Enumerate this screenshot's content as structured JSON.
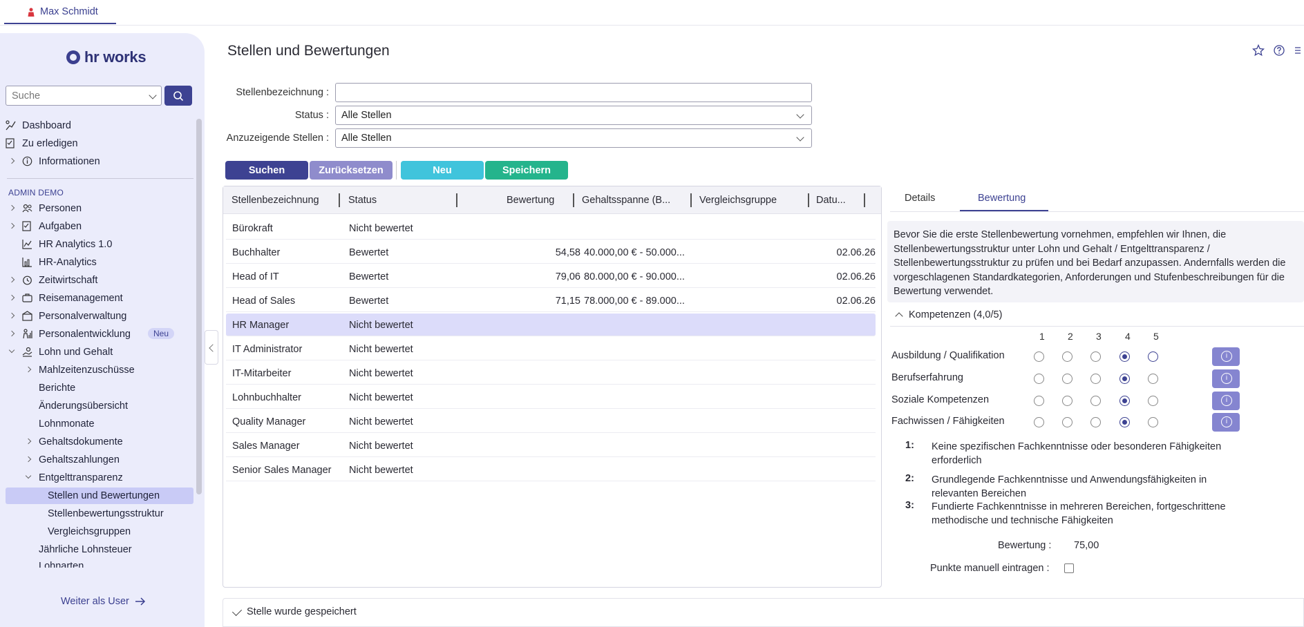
{
  "user_tab": {
    "name": "Max Schmidt"
  },
  "sidebar": {
    "logo_text": "hr works",
    "search_placeholder": "Suche",
    "top_items": [
      {
        "label": "Dashboard",
        "icon": "dashboard-icon"
      },
      {
        "label": "Zu erledigen",
        "icon": "todo-icon"
      },
      {
        "label": "Informationen",
        "icon": "info-icon"
      }
    ],
    "section_label": "ADMIN DEMO",
    "items": [
      {
        "label": "Personen",
        "icon": "people-icon"
      },
      {
        "label": "Aufgaben",
        "icon": "tasks-icon"
      },
      {
        "label": "HR Analytics 1.0",
        "icon": "line-chart-icon"
      },
      {
        "label": "HR-Analytics",
        "icon": "bar-chart-icon"
      },
      {
        "label": "Zeitwirtschaft",
        "icon": "clock-icon"
      },
      {
        "label": "Reisemanagement",
        "icon": "suitcase-icon"
      },
      {
        "label": "Personalverwaltung",
        "icon": "building-icon"
      },
      {
        "label": "Personalentwicklung",
        "icon": "development-icon",
        "badge": "Neu"
      },
      {
        "label": "Lohn und Gehalt",
        "icon": "payroll-icon"
      }
    ],
    "payroll_children": [
      "Mahlzeitenzuschüsse",
      "Berichte",
      "Änderungsübersicht",
      "Lohnmonate",
      "Gehaltsdokumente",
      "Gehaltszahlungen",
      "Entgelttransparenz"
    ],
    "transparency_children": [
      "Stellen und Bewertungen",
      "Stellenbewertungsstruktur",
      "Vergleichsgruppen"
    ],
    "after_items": [
      "Jährliche Lohnsteuer",
      "Lohnarten"
    ],
    "weiter_label": "Weiter als User"
  },
  "page": {
    "title": "Stellen und Bewertungen"
  },
  "filters": {
    "title_label": "Stellenbezeichnung :",
    "title_value": "",
    "status_label": "Status :",
    "status_value": "Alle Stellen",
    "show_label": "Anzuzeigende Stellen :",
    "show_value": "Alle Stellen"
  },
  "buttons": {
    "search": "Suchen",
    "reset": "Zurücksetzen",
    "new": "Neu",
    "save": "Speichern"
  },
  "table": {
    "columns": [
      "Stellenbezeichnung",
      "Status",
      "Bewertung",
      "Gehaltsspanne (B...",
      "Vergleichsgruppe",
      "Datu..."
    ],
    "rows": [
      {
        "name": "Bürokraft",
        "status": "Nicht bewertet",
        "score": "",
        "range": "",
        "group": "",
        "date": ""
      },
      {
        "name": "Buchhalter",
        "status": "Bewertet",
        "score": "54,58",
        "range": "40.000,00 € - 50.000...",
        "group": "",
        "date": "02.06.26"
      },
      {
        "name": "Head of IT",
        "status": "Bewertet",
        "score": "79,06",
        "range": "80.000,00 € - 90.000...",
        "group": "",
        "date": "02.06.26"
      },
      {
        "name": "Head of Sales",
        "status": "Bewertet",
        "score": "71,15",
        "range": "78.000,00 € - 89.000...",
        "group": "",
        "date": "02.06.26"
      },
      {
        "name": "HR Manager",
        "status": "Nicht bewertet",
        "score": "",
        "range": "",
        "group": "",
        "date": ""
      },
      {
        "name": "IT Administrator",
        "status": "Nicht bewertet",
        "score": "",
        "range": "",
        "group": "",
        "date": ""
      },
      {
        "name": "IT-Mitarbeiter",
        "status": "Nicht bewertet",
        "score": "",
        "range": "",
        "group": "",
        "date": ""
      },
      {
        "name": "Lohnbuchhalter",
        "status": "Nicht bewertet",
        "score": "",
        "range": "",
        "group": "",
        "date": ""
      },
      {
        "name": "Quality Manager",
        "status": "Nicht bewertet",
        "score": "",
        "range": "",
        "group": "",
        "date": ""
      },
      {
        "name": "Sales Manager",
        "status": "Nicht bewertet",
        "score": "",
        "range": "",
        "group": "",
        "date": ""
      },
      {
        "name": "Senior Sales Manager",
        "status": "Nicht bewertet",
        "score": "",
        "range": "",
        "group": "",
        "date": ""
      }
    ],
    "selected_row": "HR Manager"
  },
  "detail": {
    "tabs": [
      "Details",
      "Bewertung"
    ],
    "active_tab": "Bewertung",
    "info_text": "Bevor Sie die erste Stellenbewertung vornehmen, empfehlen wir Ihnen, die Stellenbewertungsstruktur unter Lohn und Gehalt / Entgelttransparenz / Stellenbewertungsstruktur zu prüfen und bei Bedarf anzupassen. Andernfalls werden die vorgeschlagenen Standardkategorien, Anforderungen und Stufenbeschreibungen für die Bewertung verwendet.",
    "competence_header": "Kompetenzen (4,0/5)",
    "scale": [
      "1",
      "2",
      "3",
      "4",
      "5"
    ],
    "criteria": [
      {
        "label": "Ausbildung / Qualifikation",
        "selected": 4
      },
      {
        "label": "Berufserfahrung",
        "selected": 4
      },
      {
        "label": "Soziale Kompetenzen",
        "selected": 4
      },
      {
        "label": "Fachwissen / Fähigkeiten",
        "selected": 4
      }
    ],
    "legend": [
      {
        "key": "1:",
        "text": "Keine spezifischen Fachkenntnisse oder besonderen Fähigkeiten erforderlich"
      },
      {
        "key": "2:",
        "text": "Grundlegende Fachkenntnisse und Anwendungsfähigkeiten in relevanten Bereichen"
      },
      {
        "key": "3:",
        "text": "Fundierte Fachkenntnisse in mehreren Bereichen, fortgeschrittene methodische und technische Fähigkeiten"
      }
    ],
    "score_label": "Bewertung :",
    "score_value": "75,00",
    "manual_label": "Punkte manuell eintragen :",
    "manual_checked": false
  },
  "status_bar": {
    "message": "Stelle wurde gespeichert"
  },
  "colors": {
    "primary": "#3d4292",
    "reset": "#8f8ccc",
    "new": "#40c4dc",
    "save": "#24b48c",
    "sidebar_bg": "#ebecfb",
    "selected_row": "#dcdcfa"
  }
}
